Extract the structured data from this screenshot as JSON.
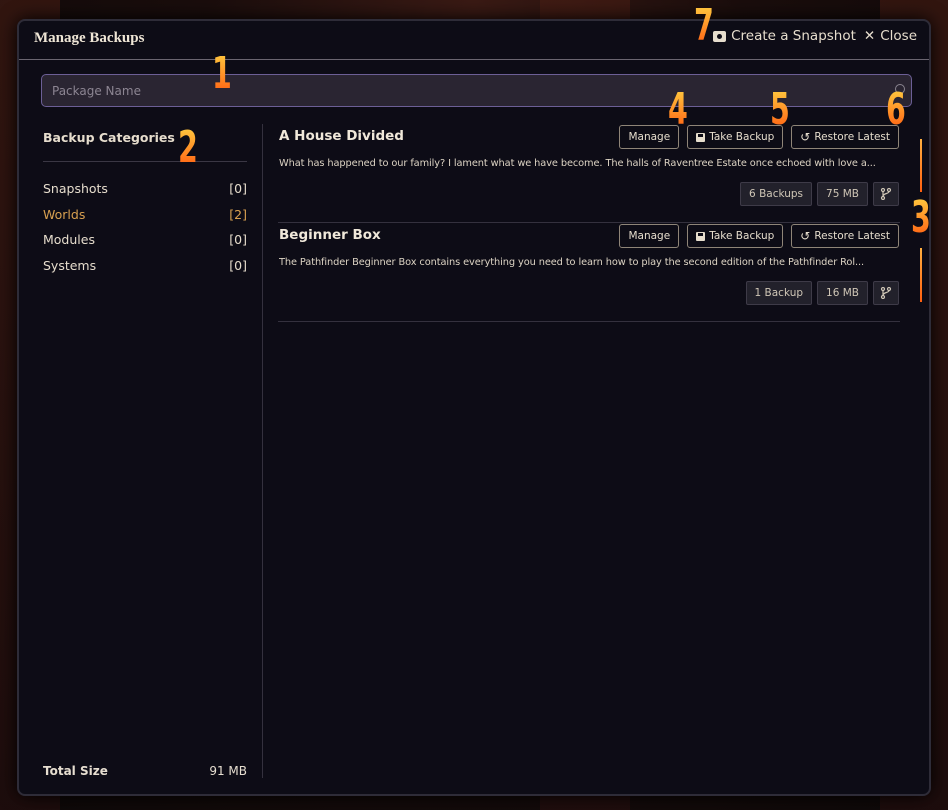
{
  "window": {
    "title": "Manage Backups",
    "actions": {
      "snapshot_label": "Create a Snapshot",
      "close_label": "Close"
    }
  },
  "search": {
    "placeholder": "Package Name",
    "value": ""
  },
  "sidebar": {
    "heading": "Backup Categories",
    "categories": [
      {
        "label": "Snapshots",
        "count": "[0]",
        "active": false
      },
      {
        "label": "Worlds",
        "count": "[2]",
        "active": true
      },
      {
        "label": "Modules",
        "count": "[0]",
        "active": false
      },
      {
        "label": "Systems",
        "count": "[0]",
        "active": false
      }
    ],
    "total_label": "Total Size",
    "total_value": "91 MB"
  },
  "packages": [
    {
      "title": "A House Divided",
      "description": "What has happened to our family? I lament what we have become. The halls of Raventree Estate once echoed with love a...",
      "buttons": {
        "manage": "Manage",
        "take_backup": "Take Backup",
        "restore_latest": "Restore Latest"
      },
      "backups": "6 Backups",
      "size": "75 MB"
    },
    {
      "title": "Beginner Box",
      "description": "The Pathfinder Beginner Box contains everything you need to learn how to play the second edition of the Pathfinder Rol...",
      "buttons": {
        "manage": "Manage",
        "take_backup": "Take Backup",
        "restore_latest": "Restore Latest"
      },
      "backups": "1 Backup",
      "size": "16 MB"
    }
  ],
  "annotations": [
    "1",
    "2",
    "3",
    "4",
    "5",
    "6",
    "7"
  ],
  "colors": {
    "accent": "#d8a050",
    "annotation": "#ff8a1a",
    "search_border": "#6c5f96"
  }
}
